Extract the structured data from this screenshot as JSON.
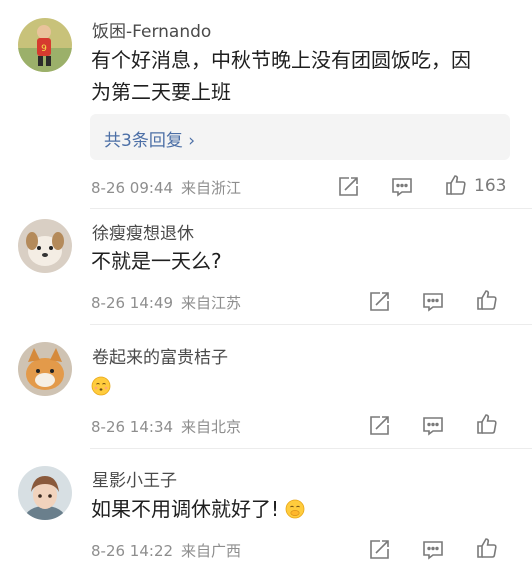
{
  "comments": [
    {
      "username": "饭困-Fernando",
      "text_line1": "有个好消息，中秋节晚上没有团圆饭吃，因",
      "text_line2": "为第二天要上班",
      "replies_label": "共3条回复 ›",
      "time": "8-26 09:44",
      "location": "来自浙江",
      "likes": "163"
    },
    {
      "username": "徐瘦瘦想退休",
      "text": "不就是一天么?",
      "time": "8-26 14:49",
      "location": "来自江苏"
    },
    {
      "username": "卷起来的富贵桔子",
      "emoji": "😙",
      "time": "8-26 14:34",
      "location": "来自北京"
    },
    {
      "username": "星影小王子",
      "text": "如果不用调休就好了!",
      "emoji": "🤭",
      "time": "8-26 14:22",
      "location": "来自广西"
    }
  ],
  "icons": {
    "share": "share-icon",
    "comment": "comment-icon",
    "like": "thumbs-up-icon"
  },
  "colors": {
    "link": "#4c6fa6",
    "meta": "#8e8e8e",
    "reply_bg": "#f4f4f4"
  }
}
